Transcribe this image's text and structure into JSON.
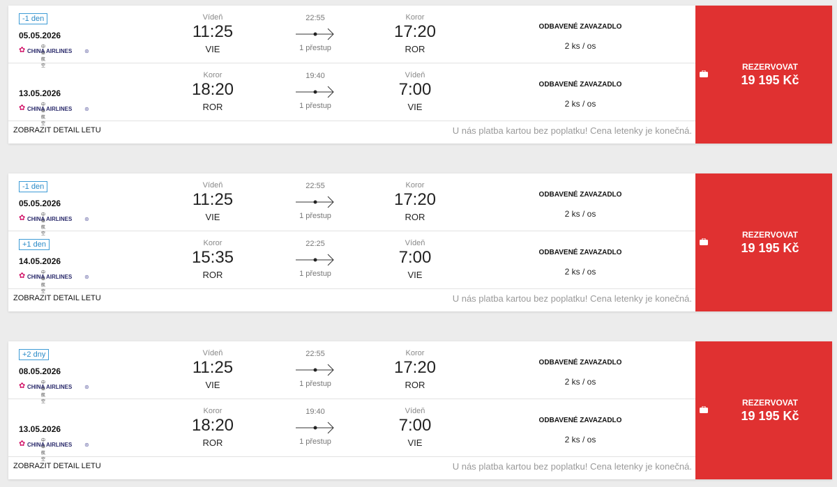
{
  "ui": {
    "detail_link": "ZOBRAZIT DETAIL LETU",
    "notice": "U nás platba kartou bez poplatku! Cena letenky je konečná.",
    "baggage_title": "ODBAVENÉ ZAVAZADLO",
    "book_label": "REZERVOVAT",
    "airline": "CHINA AIRLINES",
    "airline_cn": "中華航空"
  },
  "colors": {
    "book_bg": "#e03131",
    "badge": "#2a8ac7"
  },
  "results": [
    {
      "price": "19 195 Kč",
      "legs": [
        {
          "badge": "-1 den",
          "date": "05.05.2026",
          "dep_city": "Vídeň",
          "dep_time": "11:25",
          "dep_code": "VIE",
          "duration": "22:55",
          "stops": "1 přestup",
          "arr_city": "Koror",
          "arr_time": "17:20",
          "arr_code": "ROR",
          "baggage": "2 ks / os"
        },
        {
          "badge": "",
          "date": "13.05.2026",
          "dep_city": "Koror",
          "dep_time": "18:20",
          "dep_code": "ROR",
          "duration": "19:40",
          "stops": "1 přestup",
          "arr_city": "Vídeň",
          "arr_time": "7:00",
          "arr_code": "VIE",
          "baggage": "2 ks / os"
        }
      ]
    },
    {
      "price": "19 195 Kč",
      "legs": [
        {
          "badge": "-1 den",
          "date": "05.05.2026",
          "dep_city": "Vídeň",
          "dep_time": "11:25",
          "dep_code": "VIE",
          "duration": "22:55",
          "stops": "1 přestup",
          "arr_city": "Koror",
          "arr_time": "17:20",
          "arr_code": "ROR",
          "baggage": "2 ks / os"
        },
        {
          "badge": "+1 den",
          "date": "14.05.2026",
          "dep_city": "Koror",
          "dep_time": "15:35",
          "dep_code": "ROR",
          "duration": "22:25",
          "stops": "1 přestup",
          "arr_city": "Vídeň",
          "arr_time": "7:00",
          "arr_code": "VIE",
          "baggage": "2 ks / os"
        }
      ]
    },
    {
      "price": "19 195 Kč",
      "legs": [
        {
          "badge": "+2 dny",
          "date": "08.05.2026",
          "dep_city": "Vídeň",
          "dep_time": "11:25",
          "dep_code": "VIE",
          "duration": "22:55",
          "stops": "1 přestup",
          "arr_city": "Koror",
          "arr_time": "17:20",
          "arr_code": "ROR",
          "baggage": "2 ks / os"
        },
        {
          "badge": "",
          "date": "13.05.2026",
          "dep_city": "Koror",
          "dep_time": "18:20",
          "dep_code": "ROR",
          "duration": "19:40",
          "stops": "1 přestup",
          "arr_city": "Vídeň",
          "arr_time": "7:00",
          "arr_code": "VIE",
          "baggage": "2 ks / os"
        }
      ]
    }
  ]
}
